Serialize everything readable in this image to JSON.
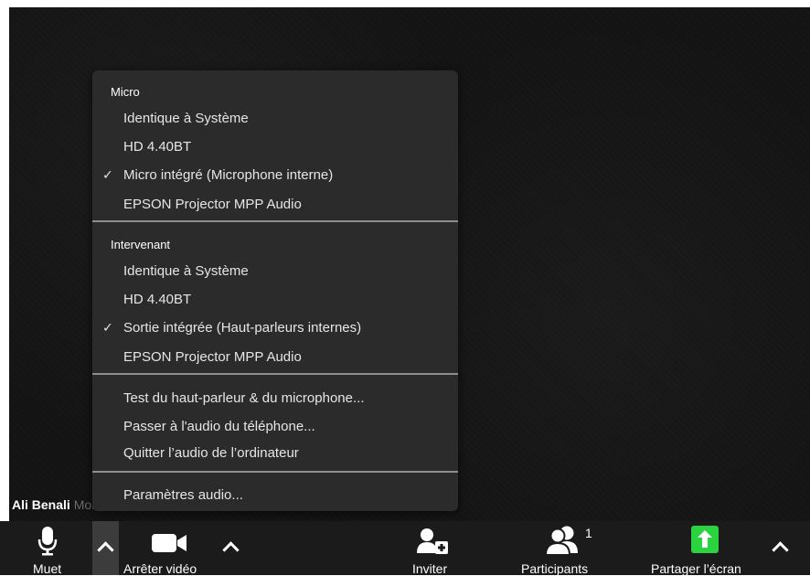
{
  "participant": {
    "name": "Ali Benali",
    "name_faded": "Mohamed Ali"
  },
  "audio_menu": {
    "micro_header": "Micro",
    "micro_items": [
      "Identique à Système",
      "HD 4.40BT",
      "Micro intégré (Microphone interne)",
      "EPSON Projector MPP Audio"
    ],
    "speaker_header": "Intervenant",
    "speaker_items": [
      "Identique à Système",
      "HD 4.40BT",
      "Sortie intégrée (Haut-parleurs internes)",
      "EPSON Projector MPP Audio"
    ],
    "actions": [
      "Test du haut-parleur & du microphone...",
      "Passer à l'audio du téléphone...",
      "Quitter l’audio de l’ordinateur"
    ],
    "settings": "Paramètres audio...",
    "check_glyph": "✓"
  },
  "toolbar": {
    "mute_label": "Muet",
    "video_label": "Arrêter vidéo",
    "invite_label": "Inviter",
    "participants_label": "Participants",
    "participants_count": "1",
    "share_label": "Partager l’écran"
  },
  "colors": {
    "share_accent": "#2bd341",
    "menu_bg": "#2b2b2c",
    "toolbar_bg": "#1b1b1c"
  }
}
